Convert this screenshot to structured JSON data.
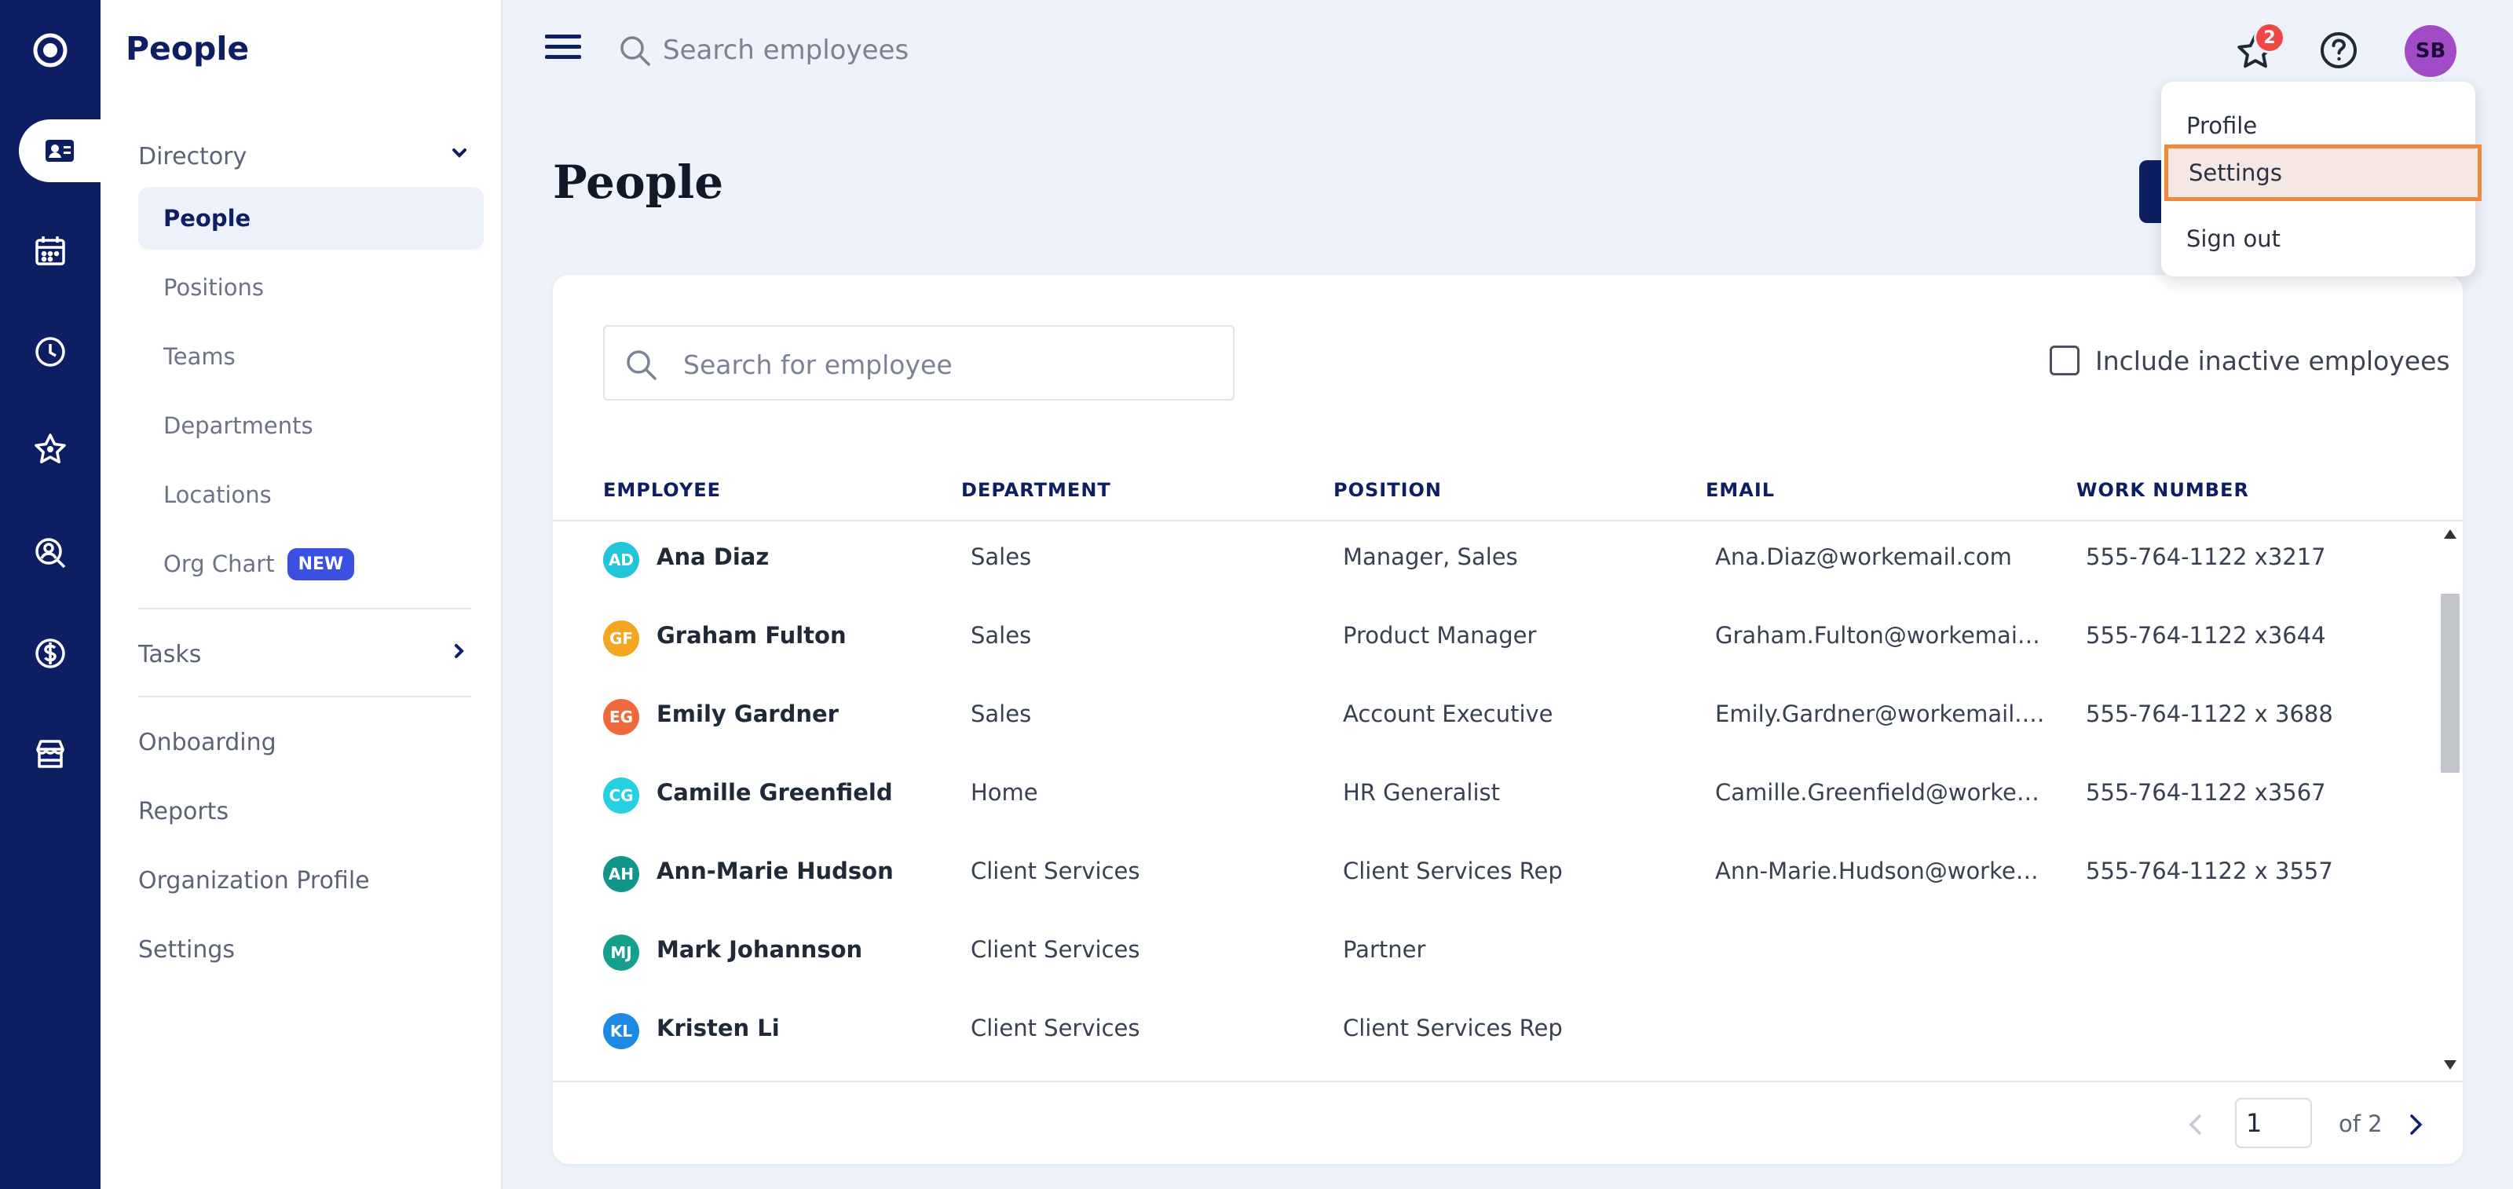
{
  "app": {
    "section_title": "People"
  },
  "header": {
    "search_placeholder": "Search employees",
    "favorites_badge": "2",
    "user_initials": "SB"
  },
  "rail": {
    "icons": [
      "app-logo-icon",
      "people-directory-icon",
      "calendar-icon",
      "clock-icon",
      "star-icon",
      "person-search-icon",
      "dollar-icon",
      "store-icon"
    ]
  },
  "sidebar": {
    "directory_label": "Directory",
    "directory_items": [
      {
        "label": "People"
      },
      {
        "label": "Positions"
      },
      {
        "label": "Teams"
      },
      {
        "label": "Departments"
      },
      {
        "label": "Locations"
      },
      {
        "label": "Org Chart",
        "badge": "NEW"
      }
    ],
    "tasks_label": "Tasks",
    "bottom_items": [
      {
        "label": "Onboarding"
      },
      {
        "label": "Reports"
      },
      {
        "label": "Organization Profile"
      },
      {
        "label": "Settings"
      }
    ]
  },
  "page": {
    "title": "People"
  },
  "filters": {
    "search_placeholder": "Search for employee",
    "include_inactive_label": "Include inactive employees",
    "include_inactive_checked": false
  },
  "table": {
    "columns": [
      "EMPLOYEE",
      "DEPARTMENT",
      "POSITION",
      "EMAIL",
      "WORK NUMBER"
    ],
    "rows": [
      {
        "initials": "AD",
        "avatar_color": "#22c5d9",
        "name": "Ana Diaz",
        "department": "Sales",
        "position": "Manager, Sales",
        "email": "Ana.Diaz@workemail.com",
        "phone": "555-764-1122 x3217"
      },
      {
        "initials": "GF",
        "avatar_color": "#f4a623",
        "name": "Graham Fulton",
        "department": "Sales",
        "position": "Product Manager",
        "email": "Graham.Fulton@workemail.c...",
        "phone": "555-764-1122 x3644"
      },
      {
        "initials": "EG",
        "avatar_color": "#ee6a3c",
        "name": "Emily Gardner",
        "department": "Sales",
        "position": "Account Executive",
        "email": "Emily.Gardner@workemail.co...",
        "phone": "555-764-1122 x 3688"
      },
      {
        "initials": "CG",
        "avatar_color": "#25d0e0",
        "name": "Camille Greenfield",
        "department": "Home",
        "position": "HR Generalist",
        "email": "Camille.Greenfield@workema...",
        "phone": "555-764-1122 x3567"
      },
      {
        "initials": "AH",
        "avatar_color": "#13968a",
        "name": "Ann-Marie Hudson",
        "department": "Client Services",
        "position": "Client Services Rep",
        "email": "Ann-Marie.Hudson@workem...",
        "phone": "555-764-1122 x 3557"
      },
      {
        "initials": "MJ",
        "avatar_color": "#15a08c",
        "name": "Mark Johannson",
        "department": "Client Services",
        "position": "Partner",
        "email": "",
        "phone": ""
      },
      {
        "initials": "KL",
        "avatar_color": "#1e88e5",
        "name": "Kristen Li",
        "department": "Client Services",
        "position": "Client Services Rep",
        "email": "",
        "phone": ""
      }
    ]
  },
  "pagination": {
    "current_page": "1",
    "of_label": "of 2"
  },
  "user_menu": {
    "items": [
      {
        "label": "Profile"
      },
      {
        "label": "Settings",
        "highlighted": true
      },
      {
        "label": "Sign out"
      }
    ]
  },
  "colors": {
    "brand_navy": "#0d1e63",
    "highlight_border": "#f0883e",
    "badge_red": "#f04848",
    "new_badge": "#3b50e0"
  }
}
